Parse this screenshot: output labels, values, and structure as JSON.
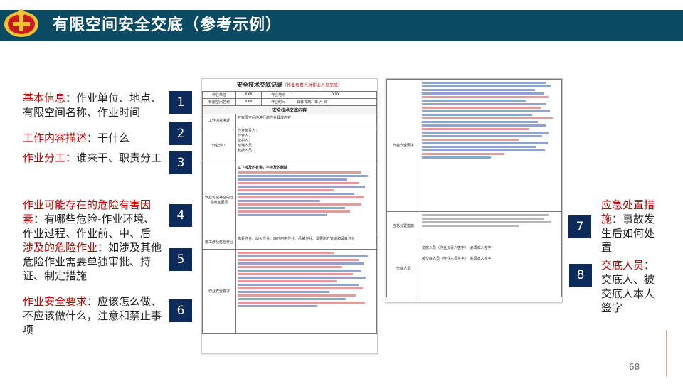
{
  "header": {
    "title": "有限空间安全交底（参考示例）",
    "logo_icon": "police-emblem-icon"
  },
  "left_items": [
    {
      "red": "基本信息",
      "text": "：作业单位、地点、有限空间名称、作业时间",
      "num": "1"
    },
    {
      "red": "工作内容描述",
      "text": "：干什么",
      "num": "2"
    },
    {
      "red": "作业分工",
      "text": "：谁来干、职责分工",
      "num": "3"
    },
    {
      "red": "作业可能存在的危险有害因素",
      "text": "：有哪些危险-作业环境、作业过程、作业前、中、后",
      "num": "4"
    },
    {
      "red": "涉及的危险作业",
      "text": "：如涉及其他危险作业需要单独审批、持证、制定措施",
      "num": "5"
    },
    {
      "red": "作业安全要求",
      "text": "：应该怎么做、不应该做什么，注意和禁止事项",
      "num": "6"
    }
  ],
  "right_items": [
    {
      "red": "应急处置措施",
      "text": "：事故发生后如何处置",
      "num": "7"
    },
    {
      "red": "交底人员",
      "text": "：交底人、被交底人本人签字",
      "num": "8"
    }
  ],
  "doc1": {
    "title": "安全技术交底记录",
    "title_note": "（作业负责人对作业人员交底）",
    "r1": [
      "作业单位",
      "XXX",
      "作业地点",
      "XXX"
    ],
    "r2": [
      "有限空间名称",
      "XXX",
      "作业时间",
      "具体日期、年-月-日"
    ],
    "section": "安全技术交底内容",
    "work_label": "工作内容描述",
    "work_text": "在有限空间内进行的作业具体内容",
    "division_label": "作业分工",
    "division_lines": [
      "作业负责人：",
      "作业人：",
      "监护人：",
      "检测人员：",
      "救援人员："
    ],
    "hazard_label": "作业可能存在的危险有害因素",
    "hazard_title": "以下涉及的有害，不涉及的删除",
    "special_label": "施工涉及危险作业",
    "special_text": "高处作业、动火作业、临时用电作业、吊装作业、需要断开管道和设备作业",
    "safety_label": "作业安全要求"
  },
  "doc2": {
    "safety_label": "作业安全要求",
    "emergency_label": "应急处置措施",
    "sign_label": "交底人员",
    "sign_1": "交底人员（作业负责人签字）：必须本人签字",
    "sign_2": "被交底人员（作业人员签字）：必须本人签字"
  },
  "page_number": "68"
}
